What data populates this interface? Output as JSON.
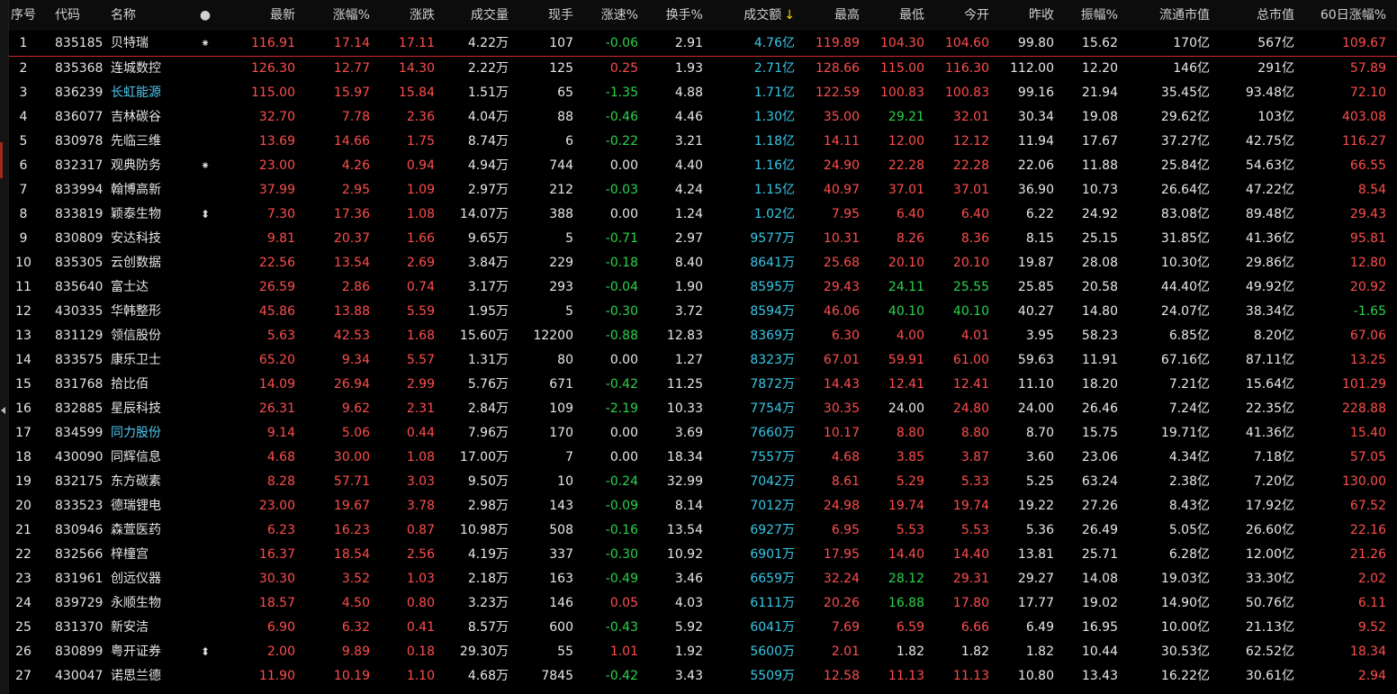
{
  "header": {
    "seq": "序号",
    "code": "代码",
    "name": "名称",
    "mark": "●",
    "price": "最新",
    "pct": "涨幅%",
    "chg": "涨跌",
    "vol": "成交量",
    "hand": "现手",
    "speed": "涨速%",
    "turn": "换手%",
    "amount": "成交额",
    "sort_icon": "↓",
    "high": "最高",
    "low": "最低",
    "open": "今开",
    "prev": "昨收",
    "amp": "振幅%",
    "float_cap": "流通市值",
    "total_cap": "总市值",
    "d60": "60日涨幅%"
  },
  "colors": {
    "up": "#ff4d4d",
    "down": "#2bd34c",
    "flat": "#e8e8e8",
    "amount": "#37c8e8",
    "name_highlight": "#4fc8f0",
    "sort_arrow": "#f5d400"
  },
  "rows": [
    {
      "seq": "1",
      "code": "835185",
      "name": "贝特瑞",
      "mark": "⁕",
      "price": "116.91",
      "pct": "17.14",
      "chg": "17.11",
      "vol": "4.22万",
      "hand": "107",
      "speed": "-0.06",
      "turn": "2.91",
      "amount": "4.76亿",
      "high": "119.89",
      "low": "104.30",
      "open": "104.60",
      "prev": "99.80",
      "amp": "15.62",
      "float_cap": "170亿",
      "total_cap": "567亿",
      "d60": "109.67"
    },
    {
      "seq": "2",
      "code": "835368",
      "name": "连城数控",
      "mark": "",
      "price": "126.30",
      "pct": "12.77",
      "chg": "14.30",
      "vol": "2.22万",
      "hand": "125",
      "speed": "0.25",
      "turn": "1.93",
      "amount": "2.71亿",
      "high": "128.66",
      "low": "115.00",
      "open": "116.30",
      "prev": "112.00",
      "amp": "12.20",
      "float_cap": "146亿",
      "total_cap": "291亿",
      "d60": "57.89"
    },
    {
      "seq": "3",
      "code": "836239",
      "name": "长虹能源",
      "mark": "",
      "price": "115.00",
      "pct": "15.97",
      "chg": "15.84",
      "vol": "1.51万",
      "hand": "65",
      "speed": "-1.35",
      "turn": "4.88",
      "amount": "1.71亿",
      "high": "122.59",
      "low": "100.83",
      "open": "100.83",
      "prev": "99.16",
      "amp": "21.94",
      "float_cap": "35.45亿",
      "total_cap": "93.48亿",
      "d60": "72.10"
    },
    {
      "seq": "4",
      "code": "836077",
      "name": "吉林碳谷",
      "mark": "",
      "price": "32.70",
      "pct": "7.78",
      "chg": "2.36",
      "vol": "4.04万",
      "hand": "88",
      "speed": "-0.46",
      "turn": "4.46",
      "amount": "1.30亿",
      "high": "35.00",
      "low": "29.21",
      "open": "32.01",
      "prev": "30.34",
      "amp": "19.08",
      "float_cap": "29.62亿",
      "total_cap": "103亿",
      "d60": "403.08"
    },
    {
      "seq": "5",
      "code": "830978",
      "name": "先临三维",
      "mark": "",
      "price": "13.69",
      "pct": "14.66",
      "chg": "1.75",
      "vol": "8.74万",
      "hand": "6",
      "speed": "-0.22",
      "turn": "3.21",
      "amount": "1.18亿",
      "high": "14.11",
      "low": "12.00",
      "open": "12.12",
      "prev": "11.94",
      "amp": "17.67",
      "float_cap": "37.27亿",
      "total_cap": "42.75亿",
      "d60": "116.27"
    },
    {
      "seq": "6",
      "code": "832317",
      "name": "观典防务",
      "mark": "⁕",
      "price": "23.00",
      "pct": "4.26",
      "chg": "0.94",
      "vol": "4.94万",
      "hand": "744",
      "speed": "0.00",
      "turn": "4.40",
      "amount": "1.16亿",
      "high": "24.90",
      "low": "22.28",
      "open": "22.28",
      "prev": "22.06",
      "amp": "11.88",
      "float_cap": "25.84亿",
      "total_cap": "54.63亿",
      "d60": "66.55"
    },
    {
      "seq": "7",
      "code": "833994",
      "name": "翰博高新",
      "mark": "",
      "price": "37.99",
      "pct": "2.95",
      "chg": "1.09",
      "vol": "2.97万",
      "hand": "212",
      "speed": "-0.03",
      "turn": "4.24",
      "amount": "1.15亿",
      "high": "40.97",
      "low": "37.01",
      "open": "37.01",
      "prev": "36.90",
      "amp": "10.73",
      "float_cap": "26.64亿",
      "total_cap": "47.22亿",
      "d60": "8.54"
    },
    {
      "seq": "8",
      "code": "833819",
      "name": "颖泰生物",
      "mark": "⬍",
      "price": "7.30",
      "pct": "17.36",
      "chg": "1.08",
      "vol": "14.07万",
      "hand": "388",
      "speed": "0.00",
      "turn": "1.24",
      "amount": "1.02亿",
      "high": "7.95",
      "low": "6.40",
      "open": "6.40",
      "prev": "6.22",
      "amp": "24.92",
      "float_cap": "83.08亿",
      "total_cap": "89.48亿",
      "d60": "29.43"
    },
    {
      "seq": "9",
      "code": "830809",
      "name": "安达科技",
      "mark": "",
      "price": "9.81",
      "pct": "20.37",
      "chg": "1.66",
      "vol": "9.65万",
      "hand": "5",
      "speed": "-0.71",
      "turn": "2.97",
      "amount": "9577万",
      "high": "10.31",
      "low": "8.26",
      "open": "8.36",
      "prev": "8.15",
      "amp": "25.15",
      "float_cap": "31.85亿",
      "total_cap": "41.36亿",
      "d60": "95.81"
    },
    {
      "seq": "10",
      "code": "835305",
      "name": "云创数据",
      "mark": "",
      "price": "22.56",
      "pct": "13.54",
      "chg": "2.69",
      "vol": "3.84万",
      "hand": "229",
      "speed": "-0.18",
      "turn": "8.40",
      "amount": "8641万",
      "high": "25.68",
      "low": "20.10",
      "open": "20.10",
      "prev": "19.87",
      "amp": "28.08",
      "float_cap": "10.30亿",
      "total_cap": "29.86亿",
      "d60": "12.80"
    },
    {
      "seq": "11",
      "code": "835640",
      "name": "富士达",
      "mark": "",
      "price": "26.59",
      "pct": "2.86",
      "chg": "0.74",
      "vol": "3.17万",
      "hand": "293",
      "speed": "-0.04",
      "turn": "1.90",
      "amount": "8595万",
      "high": "29.43",
      "low": "24.11",
      "open": "25.55",
      "prev": "25.85",
      "amp": "20.58",
      "float_cap": "44.40亿",
      "total_cap": "49.92亿",
      "d60": "20.92"
    },
    {
      "seq": "12",
      "code": "430335",
      "name": "华韩整形",
      "mark": "",
      "price": "45.86",
      "pct": "13.88",
      "chg": "5.59",
      "vol": "1.95万",
      "hand": "5",
      "speed": "-0.30",
      "turn": "3.72",
      "amount": "8594万",
      "high": "46.06",
      "low": "40.10",
      "open": "40.10",
      "prev": "40.27",
      "amp": "14.80",
      "float_cap": "24.07亿",
      "total_cap": "38.34亿",
      "d60": "-1.65"
    },
    {
      "seq": "13",
      "code": "831129",
      "name": "领信股份",
      "mark": "",
      "price": "5.63",
      "pct": "42.53",
      "chg": "1.68",
      "vol": "15.60万",
      "hand": "12200",
      "speed": "-0.88",
      "turn": "12.83",
      "amount": "8369万",
      "high": "6.30",
      "low": "4.00",
      "open": "4.01",
      "prev": "3.95",
      "amp": "58.23",
      "float_cap": "6.85亿",
      "total_cap": "8.20亿",
      "d60": "67.06"
    },
    {
      "seq": "14",
      "code": "833575",
      "name": "康乐卫士",
      "mark": "",
      "price": "65.20",
      "pct": "9.34",
      "chg": "5.57",
      "vol": "1.31万",
      "hand": "80",
      "speed": "0.00",
      "turn": "1.27",
      "amount": "8323万",
      "high": "67.01",
      "low": "59.91",
      "open": "61.00",
      "prev": "59.63",
      "amp": "11.91",
      "float_cap": "67.16亿",
      "total_cap": "87.11亿",
      "d60": "13.25"
    },
    {
      "seq": "15",
      "code": "831768",
      "name": "拾比佰",
      "mark": "",
      "price": "14.09",
      "pct": "26.94",
      "chg": "2.99",
      "vol": "5.76万",
      "hand": "671",
      "speed": "-0.42",
      "turn": "11.25",
      "amount": "7872万",
      "high": "14.43",
      "low": "12.41",
      "open": "12.41",
      "prev": "11.10",
      "amp": "18.20",
      "float_cap": "7.21亿",
      "total_cap": "15.64亿",
      "d60": "101.29"
    },
    {
      "seq": "16",
      "code": "832885",
      "name": "星辰科技",
      "mark": "",
      "price": "26.31",
      "pct": "9.62",
      "chg": "2.31",
      "vol": "2.84万",
      "hand": "109",
      "speed": "-2.19",
      "turn": "10.33",
      "amount": "7754万",
      "high": "30.35",
      "low": "24.00",
      "open": "24.80",
      "prev": "24.00",
      "amp": "26.46",
      "float_cap": "7.24亿",
      "total_cap": "22.35亿",
      "d60": "228.88"
    },
    {
      "seq": "17",
      "code": "834599",
      "name": "同力股份",
      "mark": "",
      "price": "9.14",
      "pct": "5.06",
      "chg": "0.44",
      "vol": "7.96万",
      "hand": "170",
      "speed": "0.00",
      "turn": "3.69",
      "amount": "7660万",
      "high": "10.17",
      "low": "8.80",
      "open": "8.80",
      "prev": "8.70",
      "amp": "15.75",
      "float_cap": "19.71亿",
      "total_cap": "41.36亿",
      "d60": "15.40"
    },
    {
      "seq": "18",
      "code": "430090",
      "name": "同辉信息",
      "mark": "",
      "price": "4.68",
      "pct": "30.00",
      "chg": "1.08",
      "vol": "17.00万",
      "hand": "7",
      "speed": "0.00",
      "turn": "18.34",
      "amount": "7557万",
      "high": "4.68",
      "low": "3.85",
      "open": "3.87",
      "prev": "3.60",
      "amp": "23.06",
      "float_cap": "4.34亿",
      "total_cap": "7.18亿",
      "d60": "57.05"
    },
    {
      "seq": "19",
      "code": "832175",
      "name": "东方碳素",
      "mark": "",
      "price": "8.28",
      "pct": "57.71",
      "chg": "3.03",
      "vol": "9.50万",
      "hand": "10",
      "speed": "-0.24",
      "turn": "32.99",
      "amount": "7042万",
      "high": "8.61",
      "low": "5.29",
      "open": "5.33",
      "prev": "5.25",
      "amp": "63.24",
      "float_cap": "2.38亿",
      "total_cap": "7.20亿",
      "d60": "130.00"
    },
    {
      "seq": "20",
      "code": "833523",
      "name": "德瑞锂电",
      "mark": "",
      "price": "23.00",
      "pct": "19.67",
      "chg": "3.78",
      "vol": "2.98万",
      "hand": "143",
      "speed": "-0.09",
      "turn": "8.14",
      "amount": "7012万",
      "high": "24.98",
      "low": "19.74",
      "open": "19.74",
      "prev": "19.22",
      "amp": "27.26",
      "float_cap": "8.43亿",
      "total_cap": "17.92亿",
      "d60": "67.52"
    },
    {
      "seq": "21",
      "code": "830946",
      "name": "森萱医药",
      "mark": "",
      "price": "6.23",
      "pct": "16.23",
      "chg": "0.87",
      "vol": "10.98万",
      "hand": "508",
      "speed": "-0.16",
      "turn": "13.54",
      "amount": "6927万",
      "high": "6.95",
      "low": "5.53",
      "open": "5.53",
      "prev": "5.36",
      "amp": "26.49",
      "float_cap": "5.05亿",
      "total_cap": "26.60亿",
      "d60": "22.16"
    },
    {
      "seq": "22",
      "code": "832566",
      "name": "梓橦宫",
      "mark": "",
      "price": "16.37",
      "pct": "18.54",
      "chg": "2.56",
      "vol": "4.19万",
      "hand": "337",
      "speed": "-0.30",
      "turn": "10.92",
      "amount": "6901万",
      "high": "17.95",
      "low": "14.40",
      "open": "14.40",
      "prev": "13.81",
      "amp": "25.71",
      "float_cap": "6.28亿",
      "total_cap": "12.00亿",
      "d60": "21.26"
    },
    {
      "seq": "23",
      "code": "831961",
      "name": "创远仪器",
      "mark": "",
      "price": "30.30",
      "pct": "3.52",
      "chg": "1.03",
      "vol": "2.18万",
      "hand": "163",
      "speed": "-0.49",
      "turn": "3.46",
      "amount": "6659万",
      "high": "32.24",
      "low": "28.12",
      "open": "29.31",
      "prev": "29.27",
      "amp": "14.08",
      "float_cap": "19.03亿",
      "total_cap": "33.30亿",
      "d60": "2.02"
    },
    {
      "seq": "24",
      "code": "839729",
      "name": "永顺生物",
      "mark": "",
      "price": "18.57",
      "pct": "4.50",
      "chg": "0.80",
      "vol": "3.23万",
      "hand": "146",
      "speed": "0.05",
      "turn": "4.03",
      "amount": "6111万",
      "high": "20.26",
      "low": "16.88",
      "open": "17.80",
      "prev": "17.77",
      "amp": "19.02",
      "float_cap": "14.90亿",
      "total_cap": "50.76亿",
      "d60": "6.11"
    },
    {
      "seq": "25",
      "code": "831370",
      "name": "新安洁",
      "mark": "",
      "price": "6.90",
      "pct": "6.32",
      "chg": "0.41",
      "vol": "8.57万",
      "hand": "600",
      "speed": "-0.43",
      "turn": "5.92",
      "amount": "6041万",
      "high": "7.69",
      "low": "6.59",
      "open": "6.66",
      "prev": "6.49",
      "amp": "16.95",
      "float_cap": "10.00亿",
      "total_cap": "21.13亿",
      "d60": "9.52"
    },
    {
      "seq": "26",
      "code": "830899",
      "name": "粤开证券",
      "mark": "⬍",
      "price": "2.00",
      "pct": "9.89",
      "chg": "0.18",
      "vol": "29.30万",
      "hand": "55",
      "speed": "1.01",
      "turn": "1.92",
      "amount": "5600万",
      "high": "2.01",
      "low": "1.82",
      "open": "1.82",
      "prev": "1.82",
      "amp": "10.44",
      "float_cap": "30.53亿",
      "total_cap": "62.52亿",
      "d60": "18.34"
    },
    {
      "seq": "27",
      "code": "430047",
      "name": "诺思兰德",
      "mark": "",
      "price": "11.90",
      "pct": "10.19",
      "chg": "1.10",
      "vol": "4.68万",
      "hand": "7845",
      "speed": "-0.42",
      "turn": "3.43",
      "amount": "5509万",
      "high": "12.58",
      "low": "11.13",
      "open": "11.13",
      "prev": "10.80",
      "amp": "13.43",
      "float_cap": "16.22亿",
      "total_cap": "30.61亿",
      "d60": "2.94"
    }
  ]
}
